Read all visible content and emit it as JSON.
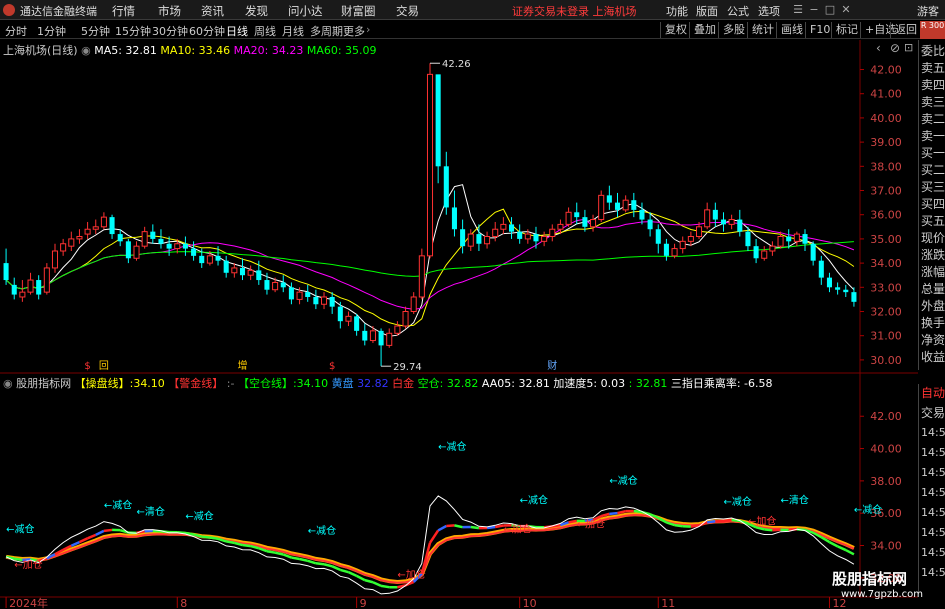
{
  "app_title": "通达信金融终端",
  "menu": [
    "行情",
    "市场",
    "资讯",
    "发现",
    "问小达",
    "财富圈",
    "交易"
  ],
  "notice": "证券交易未登录  上海机场",
  "top_right_menu": [
    "功能",
    "版面",
    "公式",
    "选项"
  ],
  "guest": "游客",
  "periods": [
    "分时",
    "1分钟",
    "5分钟",
    "15分钟",
    "30分钟",
    "60分钟",
    "日线",
    "周线",
    "月线",
    "多周期",
    "更多"
  ],
  "right_buttons": [
    "复权",
    "叠加",
    "多股",
    "统计",
    "画线",
    "F10",
    "标记",
    "+自选",
    "返回"
  ],
  "side_header": "R\n300",
  "side_items": [
    "委比",
    "卖五",
    "卖四",
    "卖三",
    "卖二",
    "卖一",
    "买一",
    "买二",
    "买三",
    "买四",
    "买五",
    "现价",
    "涨跌",
    "涨幅",
    "总量",
    "外盘",
    "换手",
    "净资",
    "收益"
  ],
  "side_items2": [
    "自动",
    "交易",
    "14:56",
    "14:56",
    "14:56",
    "14:56",
    "14:56",
    "14:56",
    "14:56",
    "14:56"
  ],
  "main_legend": {
    "name": "上海机场(日线)",
    "items": [
      {
        "label": "MA5: 32.81",
        "color": "#ffffff"
      },
      {
        "label": "MA10: 33.46",
        "color": "#ffff00"
      },
      {
        "label": "MA20: 34.23",
        "color": "#ff00ff"
      },
      {
        "label": "MA60: 35.09",
        "color": "#00ff00"
      }
    ]
  },
  "sub_legend": {
    "name": "股朋指标网",
    "items": [
      {
        "label": "【操盘线】:34.10",
        "color": "#ffff00"
      },
      {
        "label": "【警金线】",
        "color": "#ff3333"
      },
      {
        "label": ":-",
        "color": "#888888"
      },
      {
        "label": "【空仓线】:34.10",
        "color": "#00ff00"
      },
      {
        "label": "黄盘",
        "color": "#3399ff"
      },
      {
        "label": "32.82",
        "color": "#3333ff"
      },
      {
        "label": "白金",
        "color": "#ff3333"
      },
      {
        "label": "空仓: 32.82",
        "color": "#00ff00"
      },
      {
        "label": "AA05: 32.81",
        "color": "#ffffff"
      },
      {
        "label": "加速度5: 0.03",
        "color": "#ffffff"
      },
      {
        "label": ": 32.81",
        "color": "#00ff00"
      },
      {
        "label": "三指日乘离率: -6.58",
        "color": "#ffffff"
      }
    ]
  },
  "watermark": {
    "line1": "股朋指标网",
    "line2": "www.7gpzb.com"
  },
  "chart_data": [
    {
      "type": "candlestick",
      "title": "上海机场(日线)",
      "ylim": [
        29.5,
        42.6
      ],
      "yticks": [
        "42.00",
        "41.00",
        "40.00",
        "39.00",
        "38.00",
        "37.00",
        "36.00",
        "35.00",
        "34.00",
        "33.00",
        "32.00",
        "31.00",
        "30.00"
      ],
      "x_axis_labels": [
        {
          "label": "2024年",
          "index": 0
        },
        {
          "label": "8",
          "index": 21
        },
        {
          "label": "9",
          "index": 43
        },
        {
          "label": "10",
          "index": 63
        },
        {
          "label": "11",
          "index": 80
        },
        {
          "label": "12",
          "index": 101
        },
        {
          "label": "1",
          "index": 121
        }
      ],
      "candles": [
        [
          34.0,
          34.6,
          33.3,
          33.1
        ],
        [
          33.1,
          33.4,
          32.7,
          32.5
        ],
        [
          32.6,
          33.3,
          32.8,
          32.4
        ],
        [
          32.8,
          33.6,
          33.3,
          32.7
        ],
        [
          33.3,
          33.5,
          32.7,
          32.5
        ],
        [
          32.8,
          34.0,
          33.8,
          32.7
        ],
        [
          33.8,
          34.8,
          34.5,
          33.6
        ],
        [
          34.5,
          35.0,
          34.8,
          34.3
        ],
        [
          34.7,
          35.3,
          35.0,
          34.5
        ],
        [
          35.0,
          35.4,
          35.1,
          34.8
        ],
        [
          35.2,
          35.7,
          35.4,
          35.0
        ],
        [
          35.4,
          35.8,
          35.5,
          35.2
        ],
        [
          35.5,
          36.1,
          35.9,
          35.4
        ],
        [
          35.9,
          36.0,
          35.2,
          35.0
        ],
        [
          35.2,
          35.4,
          34.9,
          34.7
        ],
        [
          34.9,
          35.0,
          34.2,
          34.0
        ],
        [
          34.2,
          34.9,
          34.7,
          34.1
        ],
        [
          34.7,
          35.5,
          35.3,
          34.6
        ],
        [
          35.3,
          35.6,
          35.0,
          34.8
        ],
        [
          35.0,
          35.4,
          34.8,
          34.6
        ],
        [
          34.8,
          35.1,
          34.6,
          34.3
        ],
        [
          34.6,
          35.0,
          34.8,
          34.4
        ],
        [
          34.8,
          35.1,
          34.6,
          34.3
        ],
        [
          34.6,
          34.9,
          34.3,
          34.1
        ],
        [
          34.3,
          34.6,
          34.0,
          33.8
        ],
        [
          34.0,
          34.5,
          34.3,
          33.9
        ],
        [
          34.3,
          34.7,
          34.1,
          33.9
        ],
        [
          34.1,
          34.3,
          33.6,
          33.4
        ],
        [
          33.6,
          34.0,
          33.8,
          33.4
        ],
        [
          33.8,
          34.2,
          33.5,
          33.3
        ],
        [
          33.5,
          33.9,
          33.7,
          33.3
        ],
        [
          33.7,
          34.1,
          33.3,
          33.1
        ],
        [
          33.3,
          33.6,
          32.9,
          32.7
        ],
        [
          32.9,
          33.4,
          33.2,
          32.8
        ],
        [
          33.2,
          33.5,
          33.0,
          32.8
        ],
        [
          33.0,
          33.2,
          32.5,
          32.3
        ],
        [
          32.5,
          33.0,
          32.8,
          32.3
        ],
        [
          32.8,
          33.1,
          32.6,
          32.4
        ],
        [
          32.6,
          32.9,
          32.3,
          32.1
        ],
        [
          32.3,
          32.8,
          32.6,
          32.1
        ],
        [
          32.6,
          32.8,
          32.2,
          31.9
        ],
        [
          32.2,
          32.4,
          31.6,
          31.3
        ],
        [
          31.6,
          32.0,
          31.8,
          31.4
        ],
        [
          31.8,
          31.9,
          31.2,
          31.0
        ],
        [
          31.2,
          31.5,
          30.8,
          30.6
        ],
        [
          30.8,
          31.4,
          31.2,
          30.7
        ],
        [
          31.2,
          31.3,
          30.6,
          29.74
        ],
        [
          30.6,
          31.3,
          31.1,
          30.5
        ],
        [
          31.1,
          31.6,
          31.4,
          31.0
        ],
        [
          31.4,
          32.2,
          32.0,
          31.3
        ],
        [
          32.0,
          32.8,
          32.6,
          31.9
        ],
        [
          32.6,
          34.6,
          34.3,
          32.5
        ],
        [
          34.3,
          42.26,
          41.8,
          34.2
        ],
        [
          41.8,
          39.5,
          38.0,
          37.3
        ],
        [
          38.0,
          38.6,
          36.3,
          36.0
        ],
        [
          36.3,
          37.0,
          35.4,
          35.1
        ],
        [
          35.4,
          35.8,
          34.7,
          34.4
        ],
        [
          34.7,
          35.4,
          35.2,
          34.5
        ],
        [
          35.2,
          35.6,
          34.8,
          34.5
        ],
        [
          34.8,
          35.3,
          35.1,
          34.6
        ],
        [
          35.1,
          35.7,
          35.4,
          34.9
        ],
        [
          35.4,
          35.9,
          35.6,
          35.2
        ],
        [
          35.6,
          35.9,
          35.3,
          35.0
        ],
        [
          35.3,
          35.6,
          35.0,
          34.8
        ],
        [
          35.0,
          35.4,
          35.2,
          34.8
        ],
        [
          35.2,
          35.5,
          34.9,
          34.6
        ],
        [
          34.9,
          35.3,
          35.1,
          34.7
        ],
        [
          35.1,
          35.6,
          35.4,
          34.9
        ],
        [
          35.4,
          35.8,
          35.6,
          35.2
        ],
        [
          35.6,
          36.3,
          36.1,
          35.5
        ],
        [
          36.1,
          36.5,
          35.9,
          35.6
        ],
        [
          35.9,
          36.2,
          35.5,
          35.3
        ],
        [
          35.5,
          36.0,
          35.8,
          35.3
        ],
        [
          35.8,
          37.0,
          36.8,
          35.7
        ],
        [
          36.8,
          37.2,
          36.5,
          36.2
        ],
        [
          36.5,
          36.9,
          36.2,
          35.9
        ],
        [
          36.2,
          36.8,
          36.6,
          36.1
        ],
        [
          36.6,
          36.9,
          36.2,
          35.9
        ],
        [
          36.2,
          36.5,
          35.8,
          35.6
        ],
        [
          35.8,
          36.1,
          35.4,
          35.1
        ],
        [
          35.4,
          35.6,
          34.8,
          34.4
        ],
        [
          34.8,
          35.0,
          34.3,
          34.1
        ],
        [
          34.3,
          34.8,
          34.6,
          34.2
        ],
        [
          34.6,
          35.1,
          34.9,
          34.4
        ],
        [
          34.9,
          35.3,
          35.1,
          34.7
        ],
        [
          35.1,
          35.7,
          35.5,
          35.0
        ],
        [
          35.5,
          36.5,
          36.2,
          35.4
        ],
        [
          36.2,
          36.5,
          35.8,
          35.5
        ],
        [
          35.8,
          36.1,
          35.6,
          35.3
        ],
        [
          35.6,
          36.0,
          35.8,
          35.4
        ],
        [
          35.8,
          36.2,
          35.3,
          35.1
        ],
        [
          35.3,
          35.5,
          34.7,
          34.5
        ],
        [
          34.7,
          35.0,
          34.2,
          34.0
        ],
        [
          34.2,
          34.7,
          34.5,
          34.1
        ],
        [
          34.5,
          34.9,
          34.7,
          34.3
        ],
        [
          34.7,
          35.3,
          35.1,
          34.6
        ],
        [
          35.1,
          35.4,
          34.9,
          34.6
        ],
        [
          34.9,
          35.3,
          35.2,
          34.7
        ],
        [
          35.2,
          35.4,
          34.8,
          34.5
        ],
        [
          34.8,
          34.9,
          34.1,
          33.9
        ],
        [
          34.1,
          34.3,
          33.4,
          33.1
        ],
        [
          33.4,
          33.6,
          33.0,
          32.8
        ],
        [
          33.0,
          33.2,
          32.9,
          32.7
        ],
        [
          32.9,
          33.1,
          32.8,
          32.6
        ],
        [
          32.8,
          33.0,
          32.4,
          32.2
        ]
      ],
      "ma_legend": [
        {
          "name": "MA5",
          "value": 32.81,
          "color": "#ffffff"
        },
        {
          "name": "MA10",
          "value": 33.46,
          "color": "#ffff00"
        },
        {
          "name": "MA20",
          "value": 34.23,
          "color": "#ff00ff"
        },
        {
          "name": "MA60",
          "value": 35.09,
          "color": "#00ff00"
        }
      ],
      "annotations": [
        {
          "text": "42.26",
          "index": 52,
          "price": 42.26,
          "pos": "right"
        },
        {
          "text": "29.74",
          "index": 46,
          "price": 29.74,
          "pos": "right"
        }
      ],
      "markers": [
        {
          "text": "$",
          "index": 10,
          "color": "#ff3333"
        },
        {
          "text": "回",
          "index": 12,
          "color": "#ffcc00"
        },
        {
          "text": "增",
          "index": 29,
          "color": "#ffcc00"
        },
        {
          "text": "$",
          "index": 40,
          "color": "#ff3333"
        },
        {
          "text": "财",
          "index": 67,
          "color": "#66aaff"
        }
      ]
    },
    {
      "type": "line",
      "title": "股朋指标网",
      "ylim": [
        31.0,
        43.5
      ],
      "yticks": [
        "42.00",
        "40.00",
        "38.00",
        "36.00",
        "34.00",
        "32.00"
      ],
      "signals": [
        {
          "text": "←减仓",
          "index": 0,
          "price": 34.8,
          "color": "#00ffff"
        },
        {
          "text": "←加仓",
          "index": 1,
          "price": 32.6,
          "color": "#ff3333"
        },
        {
          "text": "←减仓",
          "index": 12,
          "price": 36.3,
          "color": "#00ffff"
        },
        {
          "text": "←清仓",
          "index": 16,
          "price": 35.9,
          "color": "#00ffff"
        },
        {
          "text": "←减仓",
          "index": 22,
          "price": 35.6,
          "color": "#00ffff"
        },
        {
          "text": "←减仓",
          "index": 37,
          "price": 34.7,
          "color": "#00ffff"
        },
        {
          "text": "←加仓",
          "index": 48,
          "price": 32.0,
          "color": "#ff3333"
        },
        {
          "text": "←减仓",
          "index": 53,
          "price": 39.9,
          "color": "#00ffff"
        },
        {
          "text": "←减仓",
          "index": 63,
          "price": 36.6,
          "color": "#00ffff"
        },
        {
          "text": "←加仓",
          "index": 61,
          "price": 34.8,
          "color": "#ff3333"
        },
        {
          "text": "←加仓",
          "index": 70,
          "price": 35.1,
          "color": "#ff3333"
        },
        {
          "text": "←减仓",
          "index": 74,
          "price": 37.8,
          "color": "#00ffff"
        },
        {
          "text": "←减仓",
          "index": 88,
          "price": 36.5,
          "color": "#00ffff"
        },
        {
          "text": "←加仓",
          "index": 91,
          "price": 35.3,
          "color": "#ff3333"
        },
        {
          "text": "←清仓",
          "index": 95,
          "price": 36.6,
          "color": "#00ffff"
        },
        {
          "text": "←减仓",
          "index": 104,
          "price": 36.0,
          "color": "#00ffff"
        }
      ]
    }
  ]
}
